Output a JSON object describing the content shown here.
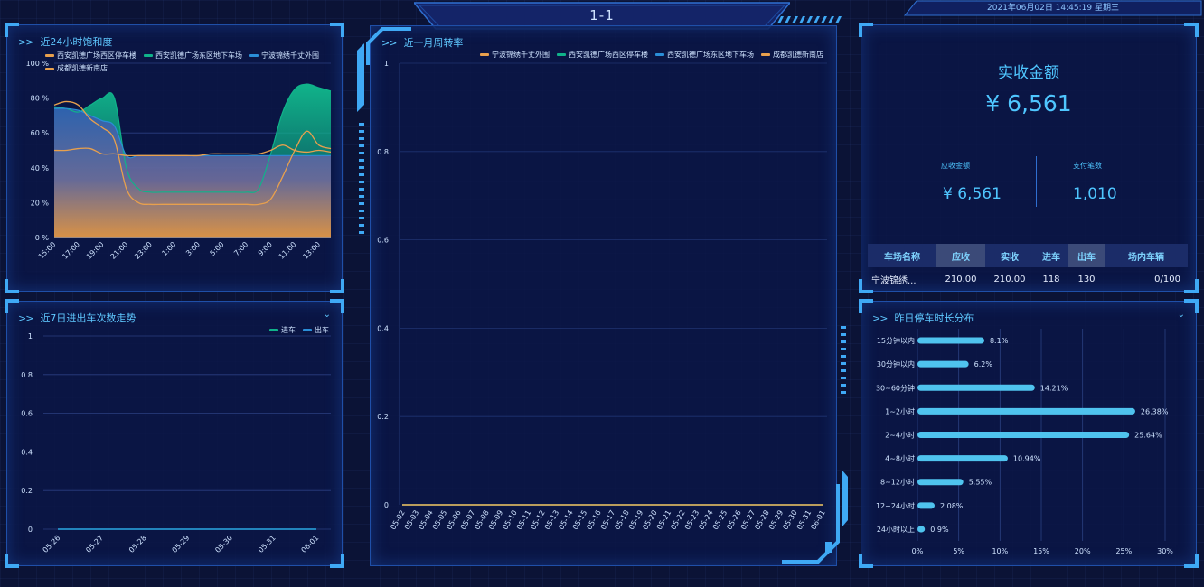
{
  "header": {
    "title": "1-1",
    "datetime": "2021年06月02日 14:45:19 星期三"
  },
  "colors": {
    "orange": "#e8a04d",
    "green": "#10b38a",
    "blue": "#2a8ed8",
    "accent": "#5fc8ff",
    "bar": "#4fc3ee"
  },
  "saturation": {
    "title": "近24小时饱和度",
    "arrow": ">>",
    "chart_data": {
      "type": "area",
      "x": [
        "15:00",
        "16:00",
        "17:00",
        "18:00",
        "19:00",
        "20:00",
        "21:00",
        "22:00",
        "23:00",
        "0:00",
        "1:00",
        "2:00",
        "3:00",
        "4:00",
        "5:00",
        "6:00",
        "7:00",
        "8:00",
        "9:00",
        "10:00",
        "11:00",
        "12:00",
        "13:00",
        "14:00"
      ],
      "xticks": [
        "15:00",
        "17:00",
        "19:00",
        "21:00",
        "23:00",
        "1:00",
        "3:00",
        "5:00",
        "7:00",
        "9:00",
        "11:00",
        "13:00"
      ],
      "ylim": [
        0,
        100
      ],
      "yticks": [
        "0 %",
        "20 %",
        "40 %",
        "60 %",
        "80 %",
        "100 %"
      ],
      "series": [
        {
          "name": "西安凯德广场西区停车楼",
          "color": "#e8a04d",
          "values": [
            76,
            78,
            76,
            68,
            63,
            56,
            28,
            20,
            19,
            19,
            19,
            19,
            19,
            19,
            19,
            19,
            19,
            19,
            22,
            35,
            50,
            61,
            53,
            51
          ]
        },
        {
          "name": "西安凯德广场东区地下车场",
          "color": "#10b38a",
          "values": [
            75,
            74,
            72,
            76,
            80,
            80,
            40,
            28,
            26,
            26,
            26,
            26,
            26,
            26,
            26,
            26,
            26,
            28,
            48,
            72,
            85,
            88,
            86,
            84
          ]
        },
        {
          "name": "宁波锦绣千丈外围",
          "color": "#2a8ed8",
          "values": [
            74,
            74,
            73,
            70,
            67,
            64,
            47,
            47,
            47,
            47,
            47,
            47,
            47,
            47,
            47,
            47,
            47,
            47,
            47,
            47,
            47,
            47,
            47,
            47
          ]
        },
        {
          "name": "成都凯德新南店",
          "color": "#e8a04d",
          "values": [
            50,
            50,
            51,
            51,
            48,
            48,
            47,
            47,
            47,
            47,
            47,
            47,
            47,
            48,
            48,
            48,
            48,
            48,
            50,
            53,
            50,
            49,
            50,
            49
          ]
        }
      ]
    }
  },
  "trend": {
    "title": "近7日进出车次数走势",
    "arrow": ">>",
    "chevron": "⌄",
    "chart_data": {
      "type": "line",
      "x": [
        "05-26",
        "05-27",
        "05-28",
        "05-29",
        "05-30",
        "05-31",
        "06-01"
      ],
      "ylim": [
        0,
        1
      ],
      "yticks": [
        "0",
        "0.2",
        "0.4",
        "0.6",
        "0.8",
        "1"
      ],
      "series": [
        {
          "name": "进车",
          "color": "#10b38a",
          "values": [
            0,
            0,
            0,
            0,
            0,
            0,
            0
          ]
        },
        {
          "name": "出车",
          "color": "#2a8ed8",
          "values": [
            0,
            0,
            0,
            0,
            0,
            0,
            0
          ]
        }
      ]
    }
  },
  "turnover": {
    "title": "近一月周转率",
    "arrow": ">>",
    "chart_data": {
      "type": "line",
      "x": [
        "05-02",
        "05-03",
        "05-04",
        "05-05",
        "05-06",
        "05-07",
        "05-08",
        "05-09",
        "05-10",
        "05-11",
        "05-12",
        "05-13",
        "05-14",
        "05-15",
        "05-16",
        "05-17",
        "05-18",
        "05-19",
        "05-20",
        "05-21",
        "05-22",
        "05-23",
        "05-24",
        "05-25",
        "05-26",
        "05-27",
        "05-28",
        "05-29",
        "05-30",
        "05-31",
        "06-01"
      ],
      "ylim": [
        0,
        1
      ],
      "yticks": [
        "0",
        "0.2",
        "0.4",
        "0.6",
        "0.8",
        "1"
      ],
      "series": [
        {
          "name": "宁波锦绣千丈外围",
          "color": "#e8a04d",
          "values": [
            0,
            0,
            0,
            0,
            0,
            0,
            0,
            0,
            0,
            0,
            0,
            0,
            0,
            0,
            0,
            0,
            0,
            0,
            0,
            0,
            0,
            0,
            0,
            0,
            0,
            0,
            0,
            0,
            0,
            0,
            0
          ]
        },
        {
          "name": "西安凯德广场西区停车楼",
          "color": "#10b38a",
          "values": [
            0,
            0,
            0,
            0,
            0,
            0,
            0,
            0,
            0,
            0,
            0,
            0,
            0,
            0,
            0,
            0,
            0,
            0,
            0,
            0,
            0,
            0,
            0,
            0,
            0,
            0,
            0,
            0,
            0,
            0,
            0
          ]
        },
        {
          "name": "西安凯德广场东区地下车场",
          "color": "#2a8ed8",
          "values": [
            0,
            0,
            0,
            0,
            0,
            0,
            0,
            0,
            0,
            0,
            0,
            0,
            0,
            0,
            0,
            0,
            0,
            0,
            0,
            0,
            0,
            0,
            0,
            0,
            0,
            0,
            0,
            0,
            0,
            0,
            0
          ]
        },
        {
          "name": "成都凯德新南店",
          "color": "#e8a04d",
          "values": [
            0,
            0,
            0,
            0,
            0,
            0,
            0,
            0,
            0,
            0,
            0,
            0,
            0,
            0,
            0,
            0,
            0,
            0,
            0,
            0,
            0,
            0,
            0,
            0,
            0,
            0,
            0,
            0,
            0,
            0,
            0
          ]
        }
      ]
    }
  },
  "revenue": {
    "main_label": "实收金额",
    "main_value": "¥ 6,561",
    "receivable_label": "应收金额",
    "receivable_value": "¥ 6,561",
    "payments_label": "支付笔数",
    "payments_value": "1,010",
    "table": {
      "headers": [
        "车场名称",
        "应收",
        "实收",
        "进车",
        "出车",
        "场内车辆"
      ],
      "rows": [
        [
          "宁波锦绣...",
          "210.00",
          "210.00",
          "118",
          "130",
          "0/100"
        ]
      ]
    }
  },
  "duration": {
    "title": "昨日停车时长分布",
    "arrow": ">>",
    "chevron": "⌄",
    "chart_data": {
      "type": "bar",
      "orientation": "horizontal",
      "categories": [
        "15分钟以内",
        "30分钟以内",
        "30~60分钟",
        "1~2小时",
        "2~4小时",
        "4~8小时",
        "8~12小时",
        "12~24小时",
        "24小时以上"
      ],
      "values": [
        8.1,
        6.2,
        14.21,
        26.38,
        25.64,
        10.94,
        5.55,
        2.08,
        0.9
      ],
      "labels": [
        "8.1%",
        "6.2%",
        "14.21%",
        "26.38%",
        "25.64%",
        "10.94%",
        "5.55%",
        "2.08%",
        "0.9%"
      ],
      "xlim": [
        0,
        30
      ],
      "xticks": [
        "0%",
        "5%",
        "10%",
        "15%",
        "20%",
        "25%",
        "30%"
      ]
    }
  }
}
